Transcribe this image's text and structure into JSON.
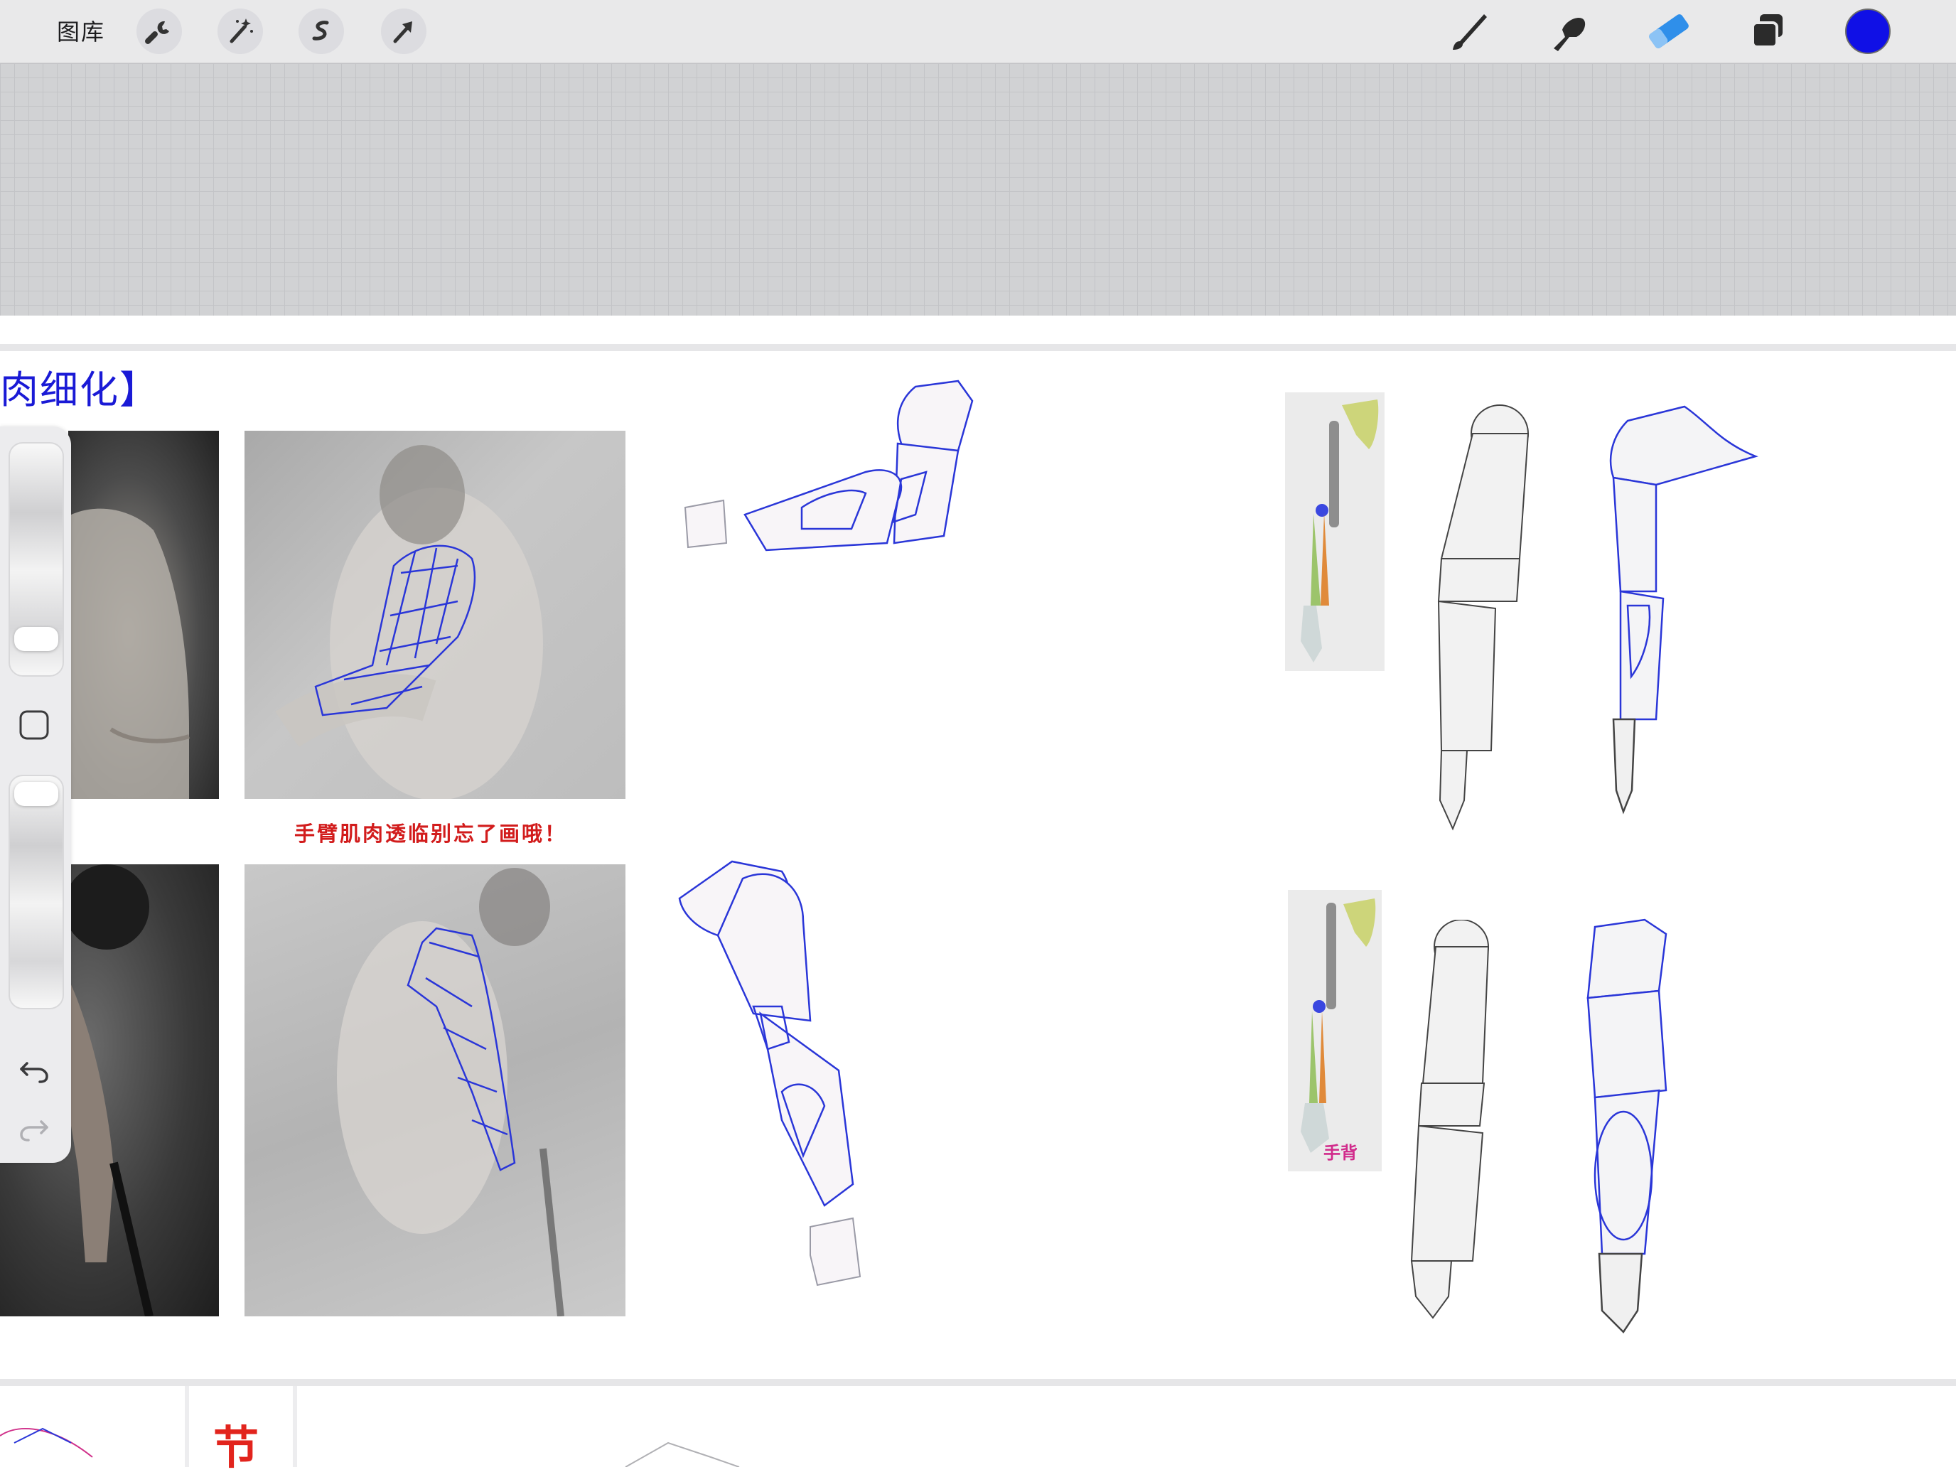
{
  "toolbar": {
    "gallery_label": "图库",
    "left_tools": [
      "wrench-icon",
      "magic-wand-icon",
      "selection-icon",
      "transform-arrow-icon"
    ],
    "right_tools": [
      "brush-icon",
      "smudge-icon",
      "eraser-icon",
      "layers-icon",
      "color-swatch"
    ],
    "active_tool": "eraser-icon",
    "accent_color": "#2f8fea",
    "current_color": "#1010e6"
  },
  "document": {
    "section_title": "肉细化】",
    "section_title_color": "#1a1ad6",
    "red_note": "手臂肌肉透临别忘了画哦！",
    "red_note_color": "#d21c1c",
    "hand_back_label": "手背",
    "hand_back_color": "#d12a8b",
    "sketch_line_color": "#2a36d8"
  },
  "side_panel": {
    "size_slider_icon": "brush-size-slider",
    "modify_icon": "modify-square-icon",
    "opacity_slider_icon": "opacity-slider",
    "undo_icon": "undo-icon",
    "redo_icon": "redo-icon"
  },
  "bottom_strip": {
    "char": "节",
    "char_color": "#e2241d"
  }
}
